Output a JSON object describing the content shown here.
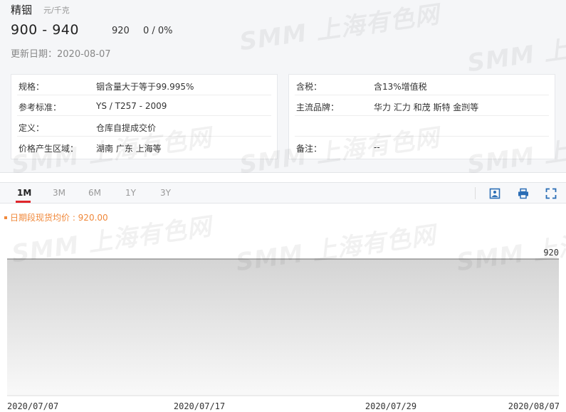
{
  "product": {
    "title": "精铟",
    "unit": "元/千克",
    "price_range": "900 - 940",
    "average": "920",
    "change": "0 / 0%",
    "update_date": "更新日期：2020-08-07"
  },
  "watermark_text": "SMM 上海有色网",
  "info_left": [
    {
      "label": "规格：",
      "value": "铟含量大于等于99.995%"
    },
    {
      "label": "参考标准：",
      "value": "YS / T257 - 2009"
    },
    {
      "label": "定义：",
      "value": "仓库自提成交价"
    },
    {
      "label": "价格产生区域：",
      "value": "湖南 广东 上海等"
    }
  ],
  "info_right": [
    {
      "label": "含税：",
      "value": "含13%增值税"
    },
    {
      "label": "主流品牌：",
      "value": "华力 汇力 和茂 斯特 金剀等"
    },
    {
      "label": "",
      "value": ""
    },
    {
      "label": "备注：",
      "value": "--"
    }
  ],
  "tabs": [
    "1M",
    "3M",
    "6M",
    "1Y",
    "3Y"
  ],
  "active_tab": "1M",
  "toolbar": {
    "image_icon": "image-download-icon",
    "print_icon": "print-icon",
    "fullscreen_icon": "fullscreen-icon"
  },
  "colors": {
    "accent": "#e0262b",
    "legend": "#f0883a",
    "line": "#888888",
    "icon": "#2a6db5"
  },
  "chart_data": {
    "type": "area",
    "title": "",
    "legend": "日期段现货均价 : 920.00",
    "x": [
      "2020/07/07",
      "2020/08/07"
    ],
    "series": [
      {
        "values": [
          920,
          920
        ]
      }
    ],
    "x_tick_labels": [
      "2020/07/07",
      "2020/07/17",
      "2020/07/29",
      "2020/08/07"
    ],
    "y_tick_labels": [
      "920"
    ],
    "grid": false
  }
}
